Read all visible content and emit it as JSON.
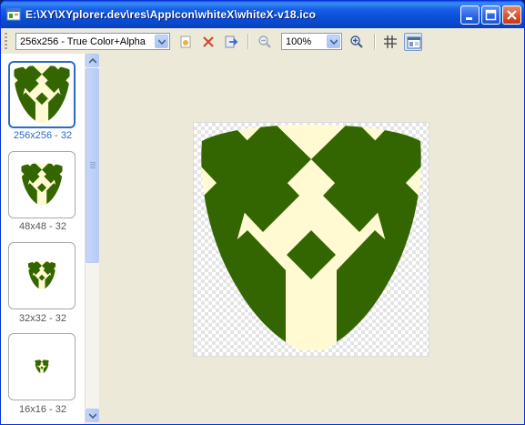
{
  "window": {
    "title": "E:\\XY\\XYplorer.dev\\res\\AppIcon\\whiteX\\whiteX-v18.ico",
    "controls": [
      "minimize-icon",
      "maximize-icon",
      "close-icon"
    ]
  },
  "toolbar": {
    "format_select": "256x256 - True Color+Alpha",
    "zoom_select": "100%",
    "buttons": [
      "new-icon",
      "delete-icon",
      "export-icon",
      "zoom-out-icon",
      "zoom-in-icon",
      "grid-icon",
      "panel-icon"
    ]
  },
  "sidebar": {
    "items": [
      {
        "label": "256x256 - 32",
        "selected": true
      },
      {
        "label": "48x48 - 32",
        "selected": false
      },
      {
        "label": "32x32 - 32",
        "selected": false
      },
      {
        "label": "16x16 - 32",
        "selected": false
      }
    ]
  },
  "preview": {
    "colors": {
      "shield": "#336600",
      "stripes": "#fffad1",
      "checker": "#e4e4e4"
    }
  }
}
